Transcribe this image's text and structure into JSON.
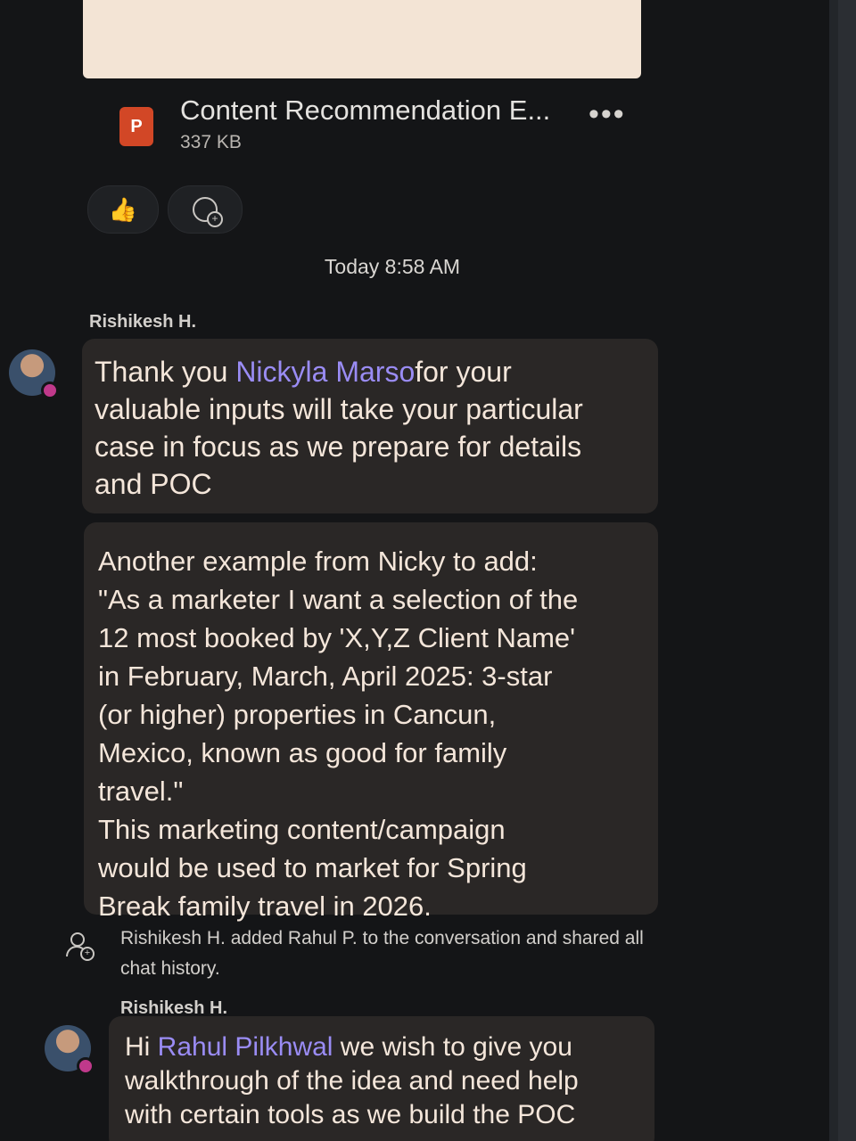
{
  "attachment": {
    "name": "Content Recommendation E...",
    "size": "337 KB",
    "icon": "powerpoint-file-icon",
    "more_icon": "more-options-icon"
  },
  "reactions": [
    {
      "icon": "thumbs-up-icon",
      "glyph": "👍"
    },
    {
      "icon": "add-reaction-icon"
    }
  ],
  "timestamp": "Today 8:58 AM",
  "messages": [
    {
      "sender": "Rishikesh H.",
      "bubbles": [
        {
          "prefix": "Thank you ",
          "mention": "Nickyla Marso",
          "lines": [
            "for your",
            "valuable inputs will take your particular",
            "case in focus as we prepare for details",
            "and POC"
          ]
        },
        {
          "lines": [
            "Another example from Nicky to add:",
            "\"As a marketer I want a selection of the",
            "12 most booked by 'X,Y,Z Client Name'",
            "in February, March, April 2025:  3-star",
            "(or higher) properties in Cancun,",
            "Mexico, known as good for family",
            "travel.\"",
            "This marketing content/campaign",
            "would be used to market for Spring",
            "Break family travel in 2026."
          ]
        }
      ]
    }
  ],
  "system_message": {
    "line1": "Rishikesh H. added Rahul P. to the conversation and shared all",
    "line2": "chat history."
  },
  "message2": {
    "sender": "Rishikesh H.",
    "prefix": "Hi ",
    "mention": "Rahul Pilkhwal",
    "line1_rest": " we wish to give you",
    "line2": "walkthrough of the idea and need help",
    "line3": "with certain tools as we build the POC"
  }
}
